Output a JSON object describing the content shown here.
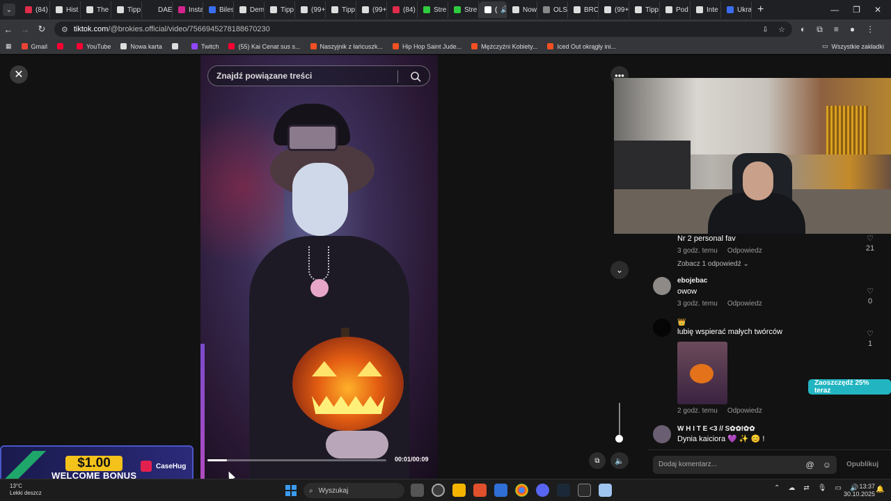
{
  "browser": {
    "tabs": [
      {
        "label": "(84)",
        "color": "#e02b4a"
      },
      {
        "label": "Hist",
        "color": "#dddddd"
      },
      {
        "label": "The",
        "color": "#dddddd"
      },
      {
        "label": "Tipp",
        "color": "#dddddd"
      },
      {
        "label": "DAE",
        "color": "#1f2023"
      },
      {
        "label": "Insta",
        "color": "#d6248f"
      },
      {
        "label": "Biles",
        "color": "#3a6df0"
      },
      {
        "label": "Dem",
        "color": "#dddddd"
      },
      {
        "label": "Tipp",
        "color": "#dddddd"
      },
      {
        "label": "(99+",
        "color": "#dddddd"
      },
      {
        "label": "Tipp",
        "color": "#dddddd"
      },
      {
        "label": "(99+",
        "color": "#dddddd"
      },
      {
        "label": "(84)",
        "color": "#e02b4a"
      },
      {
        "label": "Stre",
        "color": "#2ecc40"
      },
      {
        "label": "Stre",
        "color": "#2ecc40"
      },
      {
        "label": "(",
        "color": "#ffffff",
        "active": true
      },
      {
        "label": "Now",
        "color": "#dddddd"
      },
      {
        "label": "OLS",
        "color": "#888888"
      },
      {
        "label": "BRC",
        "color": "#dddddd"
      },
      {
        "label": "(99+",
        "color": "#dddddd"
      },
      {
        "label": "Tipp",
        "color": "#dddddd"
      },
      {
        "label": "Pod",
        "color": "#dddddd"
      },
      {
        "label": "Inte",
        "color": "#dddddd"
      },
      {
        "label": "Ukra",
        "color": "#3a6df0"
      }
    ],
    "url_host": "tiktok.com",
    "url_path": "/@brokies.official/video/7566945278188670230",
    "bookmarks": [
      {
        "label": "Gmail",
        "color": "#ea4335"
      },
      {
        "label": "",
        "color": "#ff0033"
      },
      {
        "label": "YouTube",
        "color": "#ff0033"
      },
      {
        "label": "Nowa karta",
        "color": "#dddddd"
      },
      {
        "label": "",
        "color": "#dddddd"
      },
      {
        "label": "Twitch",
        "color": "#9146ff"
      },
      {
        "label": "(55) Kai Cenat sus s...",
        "color": "#ff0033"
      },
      {
        "label": "Naszyjnik z łańcuszk...",
        "color": "#f25022"
      },
      {
        "label": "Hip Hop Saint Jude...",
        "color": "#f25022"
      },
      {
        "label": "Mężczyźni Kobiety...",
        "color": "#f25022"
      },
      {
        "label": "Iced Out okrągły ini...",
        "color": "#f25022"
      }
    ],
    "all_bookmarks": "Wszystkie zakładki"
  },
  "video": {
    "search_placeholder": "Znajdź powiązane treści",
    "time": "00:01/00:09",
    "progress": 0.11
  },
  "comments": [
    {
      "user": "",
      "text": "Nr 2 personal fav",
      "age": "3 godz. temu",
      "reply": "Odpowiedz",
      "likes": "21",
      "replies": "Zobacz 1 odpowiedź ⌄"
    },
    {
      "user": "ebojebac",
      "text": "owow",
      "age": "3 godz. temu",
      "reply": "Odpowiedz",
      "likes": "0"
    },
    {
      "user": "👑",
      "text": "lubię wspierać małych twórców",
      "age": "2 godz. temu",
      "reply": "Odpowiedz",
      "likes": "1"
    },
    {
      "user": "W H I T E <3 // S✿✿I✿✿",
      "text": "Dynia kaiciora 💜 ✨ 😊 !"
    }
  ],
  "add_comment_placeholder": "Dodaj komentarz...",
  "publish_label": "Opublikuj",
  "save_badge": "Zaoszczędź 25% teraz",
  "ad": {
    "amount": "$1.00",
    "bonus": "WELCOME BONUS",
    "brand": "CaseHug"
  },
  "taskbar": {
    "weather_temp": "13°C",
    "weather_desc": "Lekki deszcz",
    "search": "Wyszukaj",
    "time": "13:37",
    "date": "30.10.2025"
  }
}
